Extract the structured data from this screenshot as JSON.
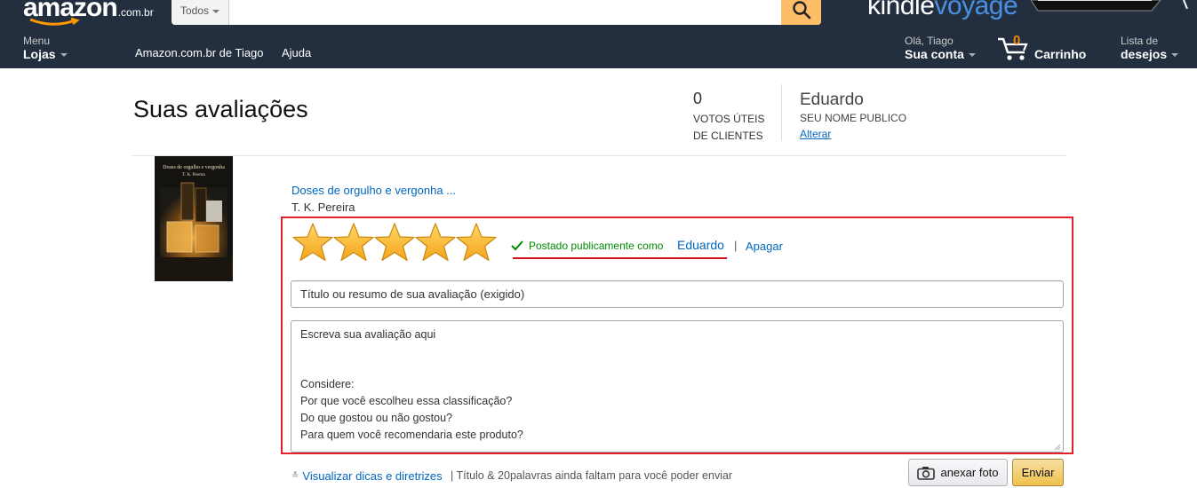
{
  "header": {
    "logo_text": "amazon",
    "logo_tld": ".com.br",
    "search": {
      "category": "Todos",
      "placeholder": ""
    },
    "promo": {
      "kindle": "kindle",
      "voyage": "voyage"
    },
    "nav": {
      "menu_small": "Menu",
      "menu_big": "Lojas",
      "your_amazon": "Amazon.com.br de Tiago",
      "help": "Ajuda",
      "account_small": "Olá, Tiago",
      "account_big": "Sua conta",
      "cart_count": "0",
      "cart_label": "Carrinho",
      "wishlist_small": "Lista de",
      "wishlist_big": "desejos"
    }
  },
  "profile": {
    "page_title": "Suas avaliações",
    "helpful_votes": "0",
    "helpful_votes_line1": "VOTOS ÚTEIS",
    "helpful_votes_line2": "DE CLIENTES",
    "public_name": "Eduardo",
    "public_name_label": "SEU NOME PUBLICO",
    "change_link": "Alterar"
  },
  "product": {
    "cover_title": "Doses de orgulho e vergonha",
    "cover_author": "T. K. Pereira",
    "title_link": "Doses de orgulho e vergonha ...",
    "author": "T. K. Pereira"
  },
  "review": {
    "rating": 5,
    "rating_max": 5,
    "posted_text": "Postado publicamente como",
    "posted_name": "Eduardo",
    "separator": "|",
    "delete_label": "Apagar",
    "title_placeholder": "Título ou resumo de sua avaliação (exigido)",
    "body_placeholder": "Escreva sua avaliação aqui\n\n\nConsidere:\nPor que você escolheu essa classificação?\nDo que gostou ou não gostou?\nPara quem você recomendaria este produto?"
  },
  "footer": {
    "tips_link": "Visualizar dicas e diretrizes",
    "remaining": "| Título & 20palavras ainda faltam para você poder enviar",
    "attach_label": "anexar foto",
    "send_label": "Enviar"
  },
  "colors": {
    "nav_bg": "#232f3e",
    "link": "#0066c0",
    "star": "#f4a41d",
    "highlight": "#e4202b",
    "posted_green": "#008a00"
  },
  "icons": {
    "search": "search-icon",
    "cart": "cart-icon",
    "check": "check-icon",
    "camera": "camera-icon",
    "star": "star-icon"
  }
}
